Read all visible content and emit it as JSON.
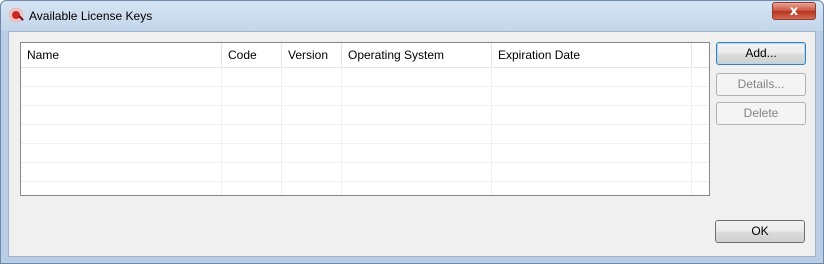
{
  "window": {
    "title": "Available License Keys",
    "close_label": "x"
  },
  "table": {
    "columns": [
      "Name",
      "Code",
      "Version",
      "Operating System",
      "Expiration Date"
    ],
    "rows": []
  },
  "buttons": {
    "add": "Add...",
    "details": "Details...",
    "delete": "Delete",
    "ok": "OK"
  }
}
